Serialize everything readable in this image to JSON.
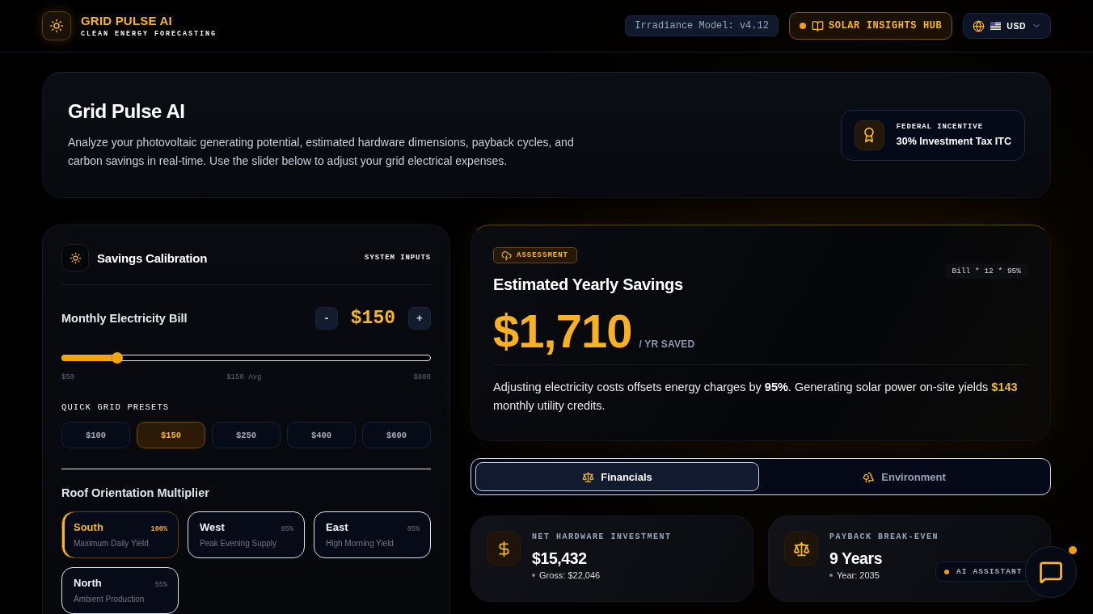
{
  "header": {
    "brand": "GRID PULSE AI",
    "tagline": "CLEAN ENERGY FORECASTING",
    "model_badge": "Irradiance Model: v4.12",
    "insights_button": "SOLAR INSIGHTS HUB",
    "currency": "USD"
  },
  "hero": {
    "title": "Grid Pulse AI",
    "description": "Analyze your photovoltaic generating potential, estimated hardware dimensions, payback cycles, and carbon savings in real-time. Use the slider below to adjust your grid electrical expenses.",
    "incentive": {
      "label": "FEDERAL INCENTIVE",
      "value": "30% Investment Tax ITC"
    }
  },
  "calibration": {
    "title": "Savings Calibration",
    "tag": "SYSTEM INPUTS",
    "bill": {
      "label": "Monthly Electricity Bill",
      "value": "$150",
      "decrease": "-",
      "increase": "+",
      "level": 0.15,
      "scale": [
        "$50",
        "$150 Avg",
        "$800"
      ]
    },
    "presets_title": "QUICK GRID PRESETS",
    "presets": [
      {
        "label": "$100",
        "selected": false
      },
      {
        "label": "$150",
        "selected": true
      },
      {
        "label": "$250",
        "selected": false
      },
      {
        "label": "$400",
        "selected": false
      },
      {
        "label": "$600",
        "selected": false
      }
    ],
    "orientation_title": "Roof Orientation Multiplier",
    "orientations": [
      {
        "name": "South",
        "multiplier": "100%",
        "description": "Maximum Daily Yield",
        "selected": true
      },
      {
        "name": "West",
        "multiplier": "85%",
        "description": "Peak Evening Supply",
        "selected": false
      },
      {
        "name": "East",
        "multiplier": "85%",
        "description": "High Morning Yield",
        "selected": false
      },
      {
        "name": "North",
        "multiplier": "55%",
        "description": "Ambient Production",
        "selected": false
      }
    ]
  },
  "assessment": {
    "badge": "ASSESSMENT",
    "formula": "Bill * 12 * 95%",
    "title": "Estimated Yearly Savings",
    "amount": "$1,710",
    "unit": "/ YR SAVED",
    "summary": "Adjusting electricity costs offsets energy charges by **95%**. Generating solar power on-site yields **$143** monthly utility credits."
  },
  "tabs": [
    {
      "kind": "financials",
      "label": "Financials",
      "selected": true
    },
    {
      "kind": "environment",
      "label": "Environment",
      "selected": false
    }
  ],
  "stats": [
    {
      "kind": "cost",
      "label": "NET HARDWARE INVESTMENT",
      "value": "$15,432",
      "detail": "Gross: $22,046"
    },
    {
      "kind": "payback",
      "label": "PAYBACK BREAK-EVEN",
      "value": "9 Years",
      "detail": "Year: 2035"
    }
  ],
  "assistant": {
    "label": "AI ASSISTANT",
    "notification": true
  }
}
